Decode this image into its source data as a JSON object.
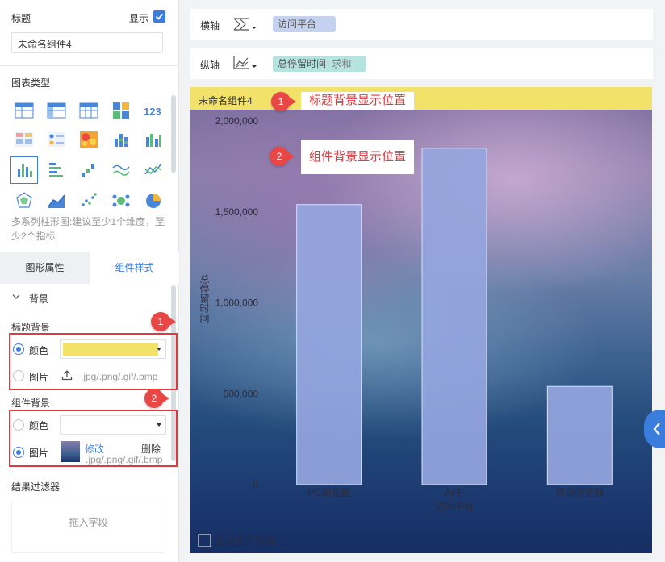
{
  "left": {
    "title_label": "标题",
    "show_label": "显示",
    "title_value": "未命名组件4",
    "chart_type_label": "图表类型",
    "chart_hint": "多系列柱形图:建议至少1个维度，至少2个指标",
    "tabs": [
      "图形属性",
      "组件样式"
    ],
    "background_section": "背景",
    "title_bg_label": "标题背景",
    "component_bg_label": "组件背景",
    "color_label": "颜色",
    "image_label": "图片",
    "title_bg_color": "#f2e26a",
    "upload_hint": ".jpg/.png/.gif/.bmp",
    "modify_label": "修改",
    "delete_label": "删除",
    "filter_label": "结果过滤器",
    "drop_hint": "拖入字段",
    "badge_1": "1",
    "badge_2": "2"
  },
  "axes": {
    "x_label": "横轴",
    "x_field": "访问平台",
    "y_label": "纵轴",
    "y_field": "总停留时间",
    "y_agg": "求和"
  },
  "chart": {
    "title": "未命名组件4",
    "callout_1": "标题背景显示位置",
    "callout_2": "组件背景显示位置"
  },
  "chart_data": {
    "type": "bar",
    "categories": [
      "PC浏览器",
      "APP",
      "移动浏览器"
    ],
    "values": [
      1540000,
      1850000,
      540000
    ],
    "title": "未命名组件4",
    "xlabel": "访问平台",
    "ylabel": "总停留时间",
    "ylim": [
      0,
      2000000
    ],
    "yticks": [
      0,
      500000,
      1000000,
      1500000,
      2000000
    ],
    "ytick_labels": [
      "0",
      "500,000",
      "1,000,000",
      "1,500,000",
      "2,000,000"
    ],
    "legend": "显示所有系列",
    "bar_color": "#95a5de"
  },
  "colors": {
    "accent": "#3b7ddd",
    "annotation": "#e0393e"
  }
}
